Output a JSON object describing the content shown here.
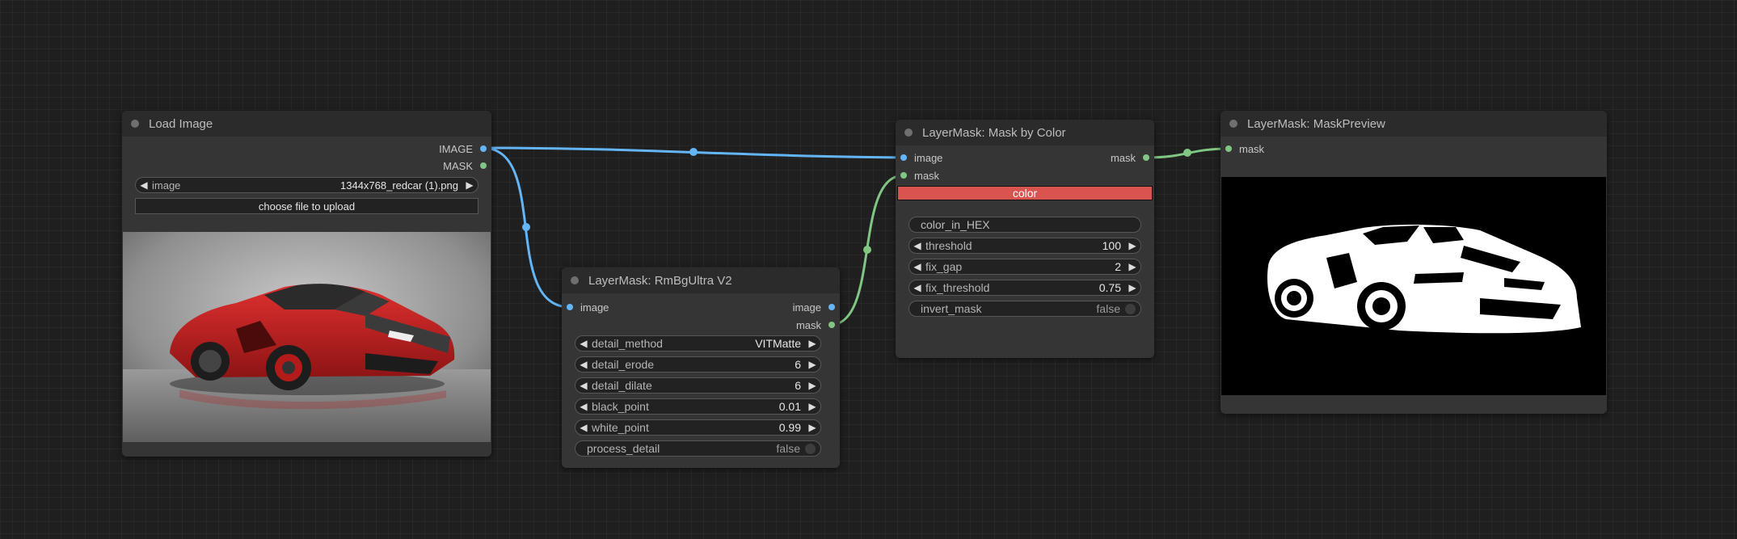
{
  "colors": {
    "image_link": "#64b5f6",
    "mask_link": "#81c784",
    "color_widget": "#d9534f"
  },
  "nodes": {
    "load_image": {
      "title": "Load Image",
      "outputs": {
        "image": "IMAGE",
        "mask": "MASK"
      },
      "image_widget": {
        "label": "image",
        "value": "1344x768_redcar (1).png"
      },
      "upload_label": "choose file to upload",
      "preview_icon": "red-sports-car-photo"
    },
    "rmbg": {
      "title": "LayerMask: RmBgUltra V2",
      "input": "image",
      "outputs": {
        "image": "image",
        "mask": "mask"
      },
      "widgets": [
        {
          "label": "detail_method",
          "value": "VITMatte"
        },
        {
          "label": "detail_erode",
          "value": "6"
        },
        {
          "label": "detail_dilate",
          "value": "6"
        },
        {
          "label": "black_point",
          "value": "0.01"
        },
        {
          "label": "white_point",
          "value": "0.99"
        }
      ],
      "toggle": {
        "label": "process_detail",
        "value": "false"
      }
    },
    "mask_by_color": {
      "title": "LayerMask: Mask by Color",
      "inputs": {
        "image": "image",
        "mask": "mask"
      },
      "output": "mask",
      "color_button": "color",
      "hex_field": "color_in_HEX",
      "widgets": [
        {
          "label": "threshold",
          "value": "100"
        },
        {
          "label": "fix_gap",
          "value": "2"
        },
        {
          "label": "fix_threshold",
          "value": "0.75"
        }
      ],
      "toggle": {
        "label": "invert_mask",
        "value": "false"
      }
    },
    "mask_preview": {
      "title": "LayerMask: MaskPreview",
      "input": "mask",
      "preview_icon": "car-mask-silhouette"
    }
  }
}
